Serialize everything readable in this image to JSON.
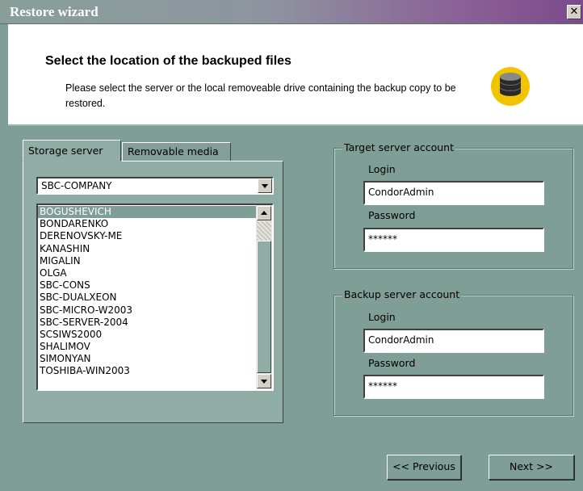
{
  "window": {
    "title": "Restore wizard",
    "close_glyph": "✕"
  },
  "header": {
    "heading": "Select the location of the backuped files",
    "description": "Please select the server or the local removeable drive containing the backup copy to be restored.",
    "icon": "database-icon",
    "icon_colors": {
      "circle": "#f2c400",
      "disks": "#2a2a2a"
    }
  },
  "tabs": [
    {
      "label": "Storage server",
      "active": true
    },
    {
      "label": "Removable media",
      "active": false
    }
  ],
  "storage": {
    "server_combo_value": "SBC-COMPANY",
    "server_list": [
      "BOGUSHEVICH",
      "BONDARENKO",
      "DERENOVSKY-ME",
      "KANASHIN",
      "MIGALIN",
      "OLGA",
      "SBC-CONS",
      "SBC-DUALXEON",
      "SBC-MICRO-W2003",
      "SBC-SERVER-2004",
      "SCSIWS2000",
      "SHALIMOV",
      "SIMONYAN",
      "TOSHIBA-WIN2003"
    ],
    "selected_item": "BOGUSHEVICH"
  },
  "target_account": {
    "legend": "Target server account",
    "login_label": "Login",
    "login_value": "CondorAdmin",
    "password_label": "Password",
    "password_value": "******"
  },
  "backup_account": {
    "legend": "Backup server account",
    "login_label": "Login",
    "login_value": "CondorAdmin",
    "password_label": "Password",
    "password_value": "******"
  },
  "buttons": {
    "previous": "<< Previous",
    "next": "Next >>"
  },
  "colors": {
    "background": "#7f9e96",
    "selection": "#7f9e96",
    "header_bg": "#ffffff"
  }
}
